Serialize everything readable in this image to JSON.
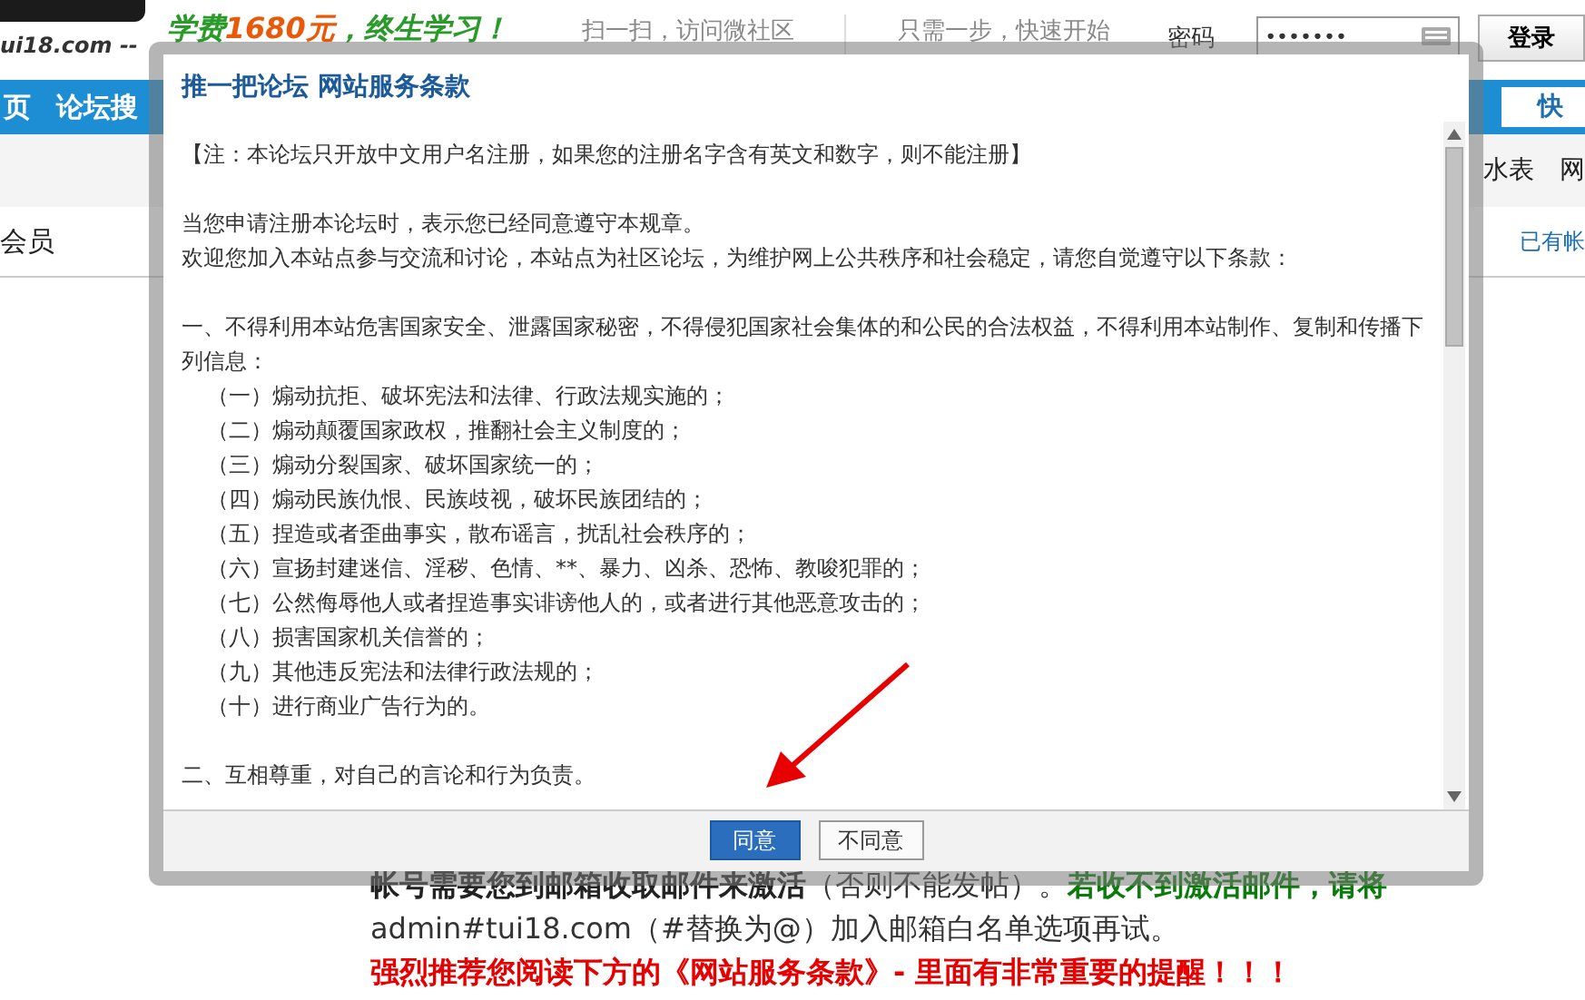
{
  "header": {
    "logo_text": "ui18.com --",
    "slogan_prefix": "学费",
    "slogan_price": "1680元",
    "slogan_suffix": "，终生学习！",
    "qr_caption": "扫一扫，访问微社区",
    "quick_start": "只需一步，快速开始",
    "password_label": "密码",
    "password_value": "•••••••",
    "login_button": "登录"
  },
  "nav": {
    "items": [
      "页",
      "论坛搜"
    ],
    "quick_button": "快"
  },
  "subnav": [
    "水表",
    "网"
  ],
  "section": {
    "title": "会员",
    "account_link": "已有帐"
  },
  "notice": [
    {
      "segments": [
        {
          "text": "帐号需要您到邮箱收取邮件来激活",
          "kind": "bold"
        },
        {
          "text": "（否则不能发帖）。",
          "kind": "normal"
        },
        {
          "text": "若收不到激活邮件，请将",
          "kind": "green"
        }
      ]
    },
    {
      "segments": [
        {
          "text": "admin#tui18.com（#替换为@）加入邮箱白名单选项再试。",
          "kind": "normal"
        }
      ]
    },
    {
      "segments": [
        {
          "text": "强烈推荐您阅读下方的《网站服务条款》- 里面有非常重要的提醒！！！",
          "kind": "red"
        }
      ]
    }
  ],
  "dialog": {
    "title": "推一把论坛 网站服务条款",
    "lines": [
      {
        "text": "【注：本论坛只开放中文用户名注册，如果您的注册名字含有英文和数字，则不能注册】",
        "kind": "para"
      },
      {
        "kind": "gap"
      },
      {
        "text": "当您申请注册本论坛时，表示您已经同意遵守本规章。",
        "kind": "para"
      },
      {
        "text": "欢迎您加入本站点参与交流和讨论，本站点为社区论坛，为维护网上公共秩序和社会稳定，请您自觉遵守以下条款：",
        "kind": "para"
      },
      {
        "kind": "gap"
      },
      {
        "text": "一、不得利用本站危害国家安全、泄露国家秘密，不得侵犯国家社会集体的和公民的合法权益，不得利用本站制作、复制和传播下列信息：",
        "kind": "para"
      },
      {
        "text": "（一）煽动抗拒、破坏宪法和法律、行政法规实施的；",
        "kind": "item"
      },
      {
        "text": "（二）煽动颠覆国家政权，推翻社会主义制度的；",
        "kind": "item"
      },
      {
        "text": "（三）煽动分裂国家、破坏国家统一的；",
        "kind": "item"
      },
      {
        "text": "（四）煽动民族仇恨、民族歧视，破坏民族团结的；",
        "kind": "item"
      },
      {
        "text": "（五）捏造或者歪曲事实，散布谣言，扰乱社会秩序的；",
        "kind": "item"
      },
      {
        "text": "（六）宣扬封建迷信、淫秽、色情、**、暴力、凶杀、恐怖、教唆犯罪的；",
        "kind": "item"
      },
      {
        "text": "（七）公然侮辱他人或者捏造事实诽谤他人的，或者进行其他恶意攻击的；",
        "kind": "item"
      },
      {
        "text": "（八）损害国家机关信誉的；",
        "kind": "item"
      },
      {
        "text": "（九）其他违反宪法和法律行政法规的；",
        "kind": "item"
      },
      {
        "text": "（十）进行商业广告行为的。",
        "kind": "item"
      },
      {
        "kind": "gap"
      },
      {
        "text": "二、互相尊重，对自己的言论和行为负责。",
        "kind": "para"
      }
    ],
    "buttons": [
      {
        "label": "同意",
        "primary": true
      },
      {
        "label": "不同意",
        "primary": false
      }
    ]
  }
}
